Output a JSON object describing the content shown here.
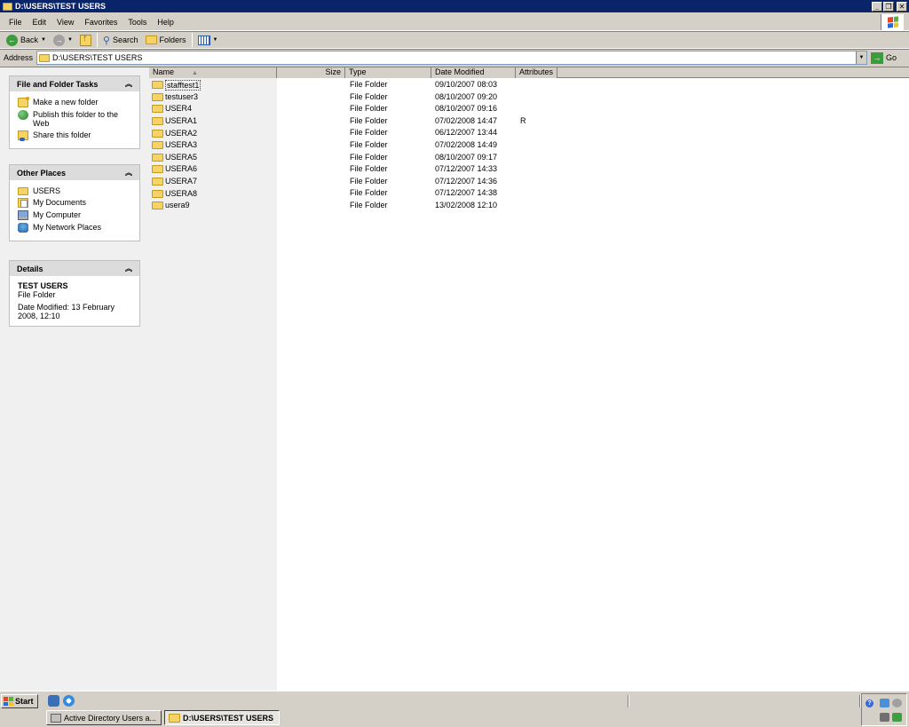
{
  "window": {
    "title": "D:\\USERS\\TEST USERS",
    "buttons": {
      "minimize": "_",
      "restore": "❐",
      "close": "✕"
    }
  },
  "menu": {
    "items": [
      {
        "label": "File"
      },
      {
        "label": "Edit"
      },
      {
        "label": "View"
      },
      {
        "label": "Favorites"
      },
      {
        "label": "Tools"
      },
      {
        "label": "Help"
      }
    ]
  },
  "toolbar": {
    "back_label": "Back",
    "search_label": "Search",
    "folders_label": "Folders"
  },
  "address": {
    "label": "Address",
    "value": "D:\\USERS\\TEST USERS",
    "go_label": "Go"
  },
  "tasks_panel": {
    "title": "File and Folder Tasks",
    "items": [
      {
        "label": "Make a new folder",
        "icon": "new-folder-icon"
      },
      {
        "label": "Publish this folder to the Web",
        "icon": "globe-icon"
      },
      {
        "label": "Share this folder",
        "icon": "share-folder-icon"
      }
    ]
  },
  "places_panel": {
    "title": "Other Places",
    "items": [
      {
        "label": "USERS",
        "icon": "folder-icon"
      },
      {
        "label": "My Documents",
        "icon": "my-documents-icon"
      },
      {
        "label": "My Computer",
        "icon": "my-computer-icon"
      },
      {
        "label": "My Network Places",
        "icon": "network-places-icon"
      }
    ]
  },
  "details_panel": {
    "title": "Details",
    "name": "TEST USERS",
    "type": "File Folder",
    "modified": "Date Modified: 13 February 2008, 12:10"
  },
  "columns": {
    "name": "Name",
    "size": "Size",
    "type": "Type",
    "date": "Date Modified",
    "attributes": "Attributes"
  },
  "files": [
    {
      "name": "stafftest1",
      "size": "",
      "type": "File Folder",
      "date": "09/10/2007 08:03",
      "attr": ""
    },
    {
      "name": "testuser3",
      "size": "",
      "type": "File Folder",
      "date": "08/10/2007 09:20",
      "attr": ""
    },
    {
      "name": "USER4",
      "size": "",
      "type": "File Folder",
      "date": "08/10/2007 09:16",
      "attr": ""
    },
    {
      "name": "USERA1",
      "size": "",
      "type": "File Folder",
      "date": "07/02/2008 14:47",
      "attr": "R"
    },
    {
      "name": "USERA2",
      "size": "",
      "type": "File Folder",
      "date": "06/12/2007 13:44",
      "attr": ""
    },
    {
      "name": "USERA3",
      "size": "",
      "type": "File Folder",
      "date": "07/02/2008 14:49",
      "attr": ""
    },
    {
      "name": "USERA5",
      "size": "",
      "type": "File Folder",
      "date": "08/10/2007 09:17",
      "attr": ""
    },
    {
      "name": "USERA6",
      "size": "",
      "type": "File Folder",
      "date": "07/12/2007 14:33",
      "attr": ""
    },
    {
      "name": "USERA7",
      "size": "",
      "type": "File Folder",
      "date": "07/12/2007 14:36",
      "attr": ""
    },
    {
      "name": "USERA8",
      "size": "",
      "type": "File Folder",
      "date": "07/12/2007 14:38",
      "attr": ""
    },
    {
      "name": "usera9",
      "size": "",
      "type": "File Folder",
      "date": "13/02/2008 12:10",
      "attr": ""
    }
  ],
  "taskbar": {
    "start_label": "Start",
    "tasks": [
      {
        "label": "Active Directory Users a...",
        "active": false
      },
      {
        "label": "D:\\USERS\\TEST USERS",
        "active": true
      }
    ]
  },
  "colors": {
    "titlebar": "#0a246a",
    "chrome": "#d4d0c8",
    "folder": "#f6d365"
  }
}
